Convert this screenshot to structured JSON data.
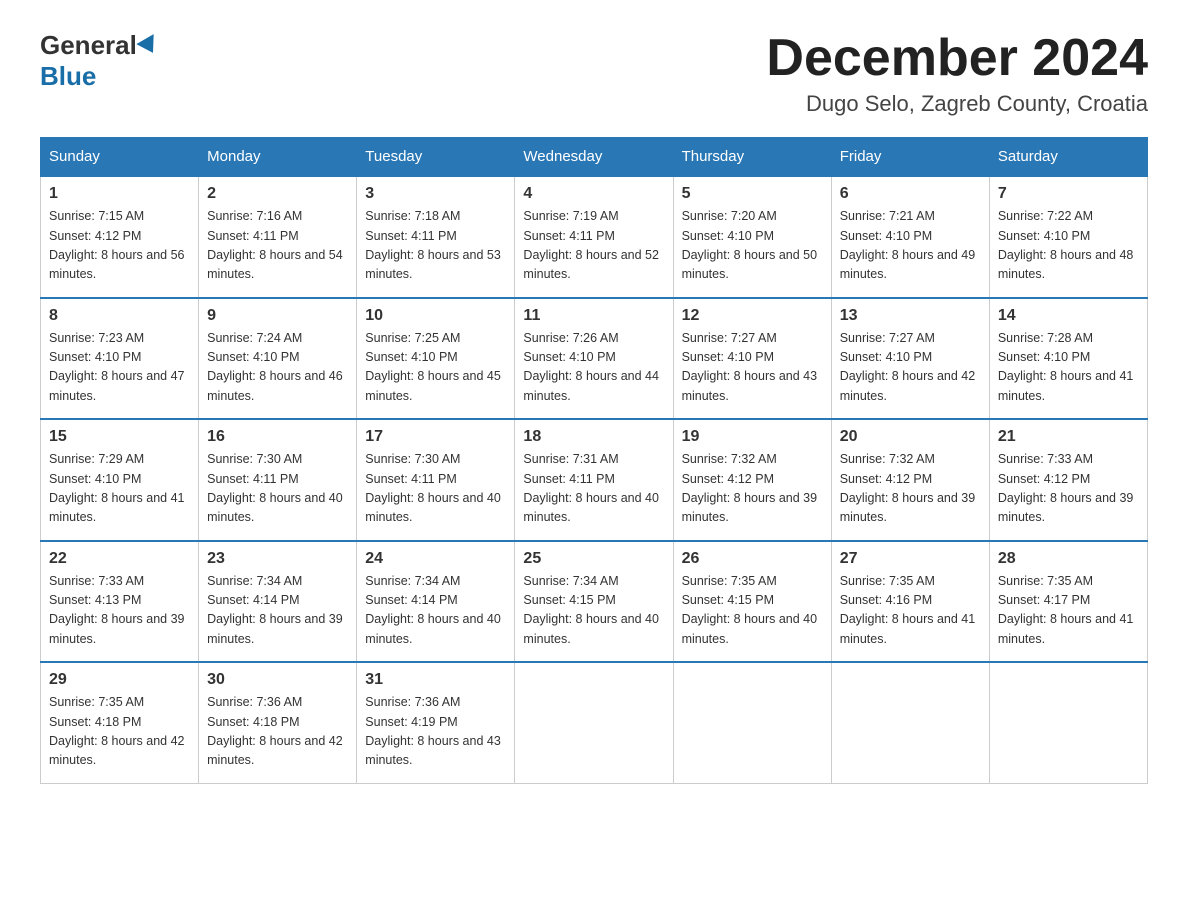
{
  "header": {
    "logo_general": "General",
    "logo_blue": "Blue",
    "month_year": "December 2024",
    "location": "Dugo Selo, Zagreb County, Croatia"
  },
  "days_of_week": [
    "Sunday",
    "Monday",
    "Tuesday",
    "Wednesday",
    "Thursday",
    "Friday",
    "Saturday"
  ],
  "weeks": [
    [
      {
        "day": "1",
        "sunrise": "7:15 AM",
        "sunset": "4:12 PM",
        "daylight": "8 hours and 56 minutes."
      },
      {
        "day": "2",
        "sunrise": "7:16 AM",
        "sunset": "4:11 PM",
        "daylight": "8 hours and 54 minutes."
      },
      {
        "day": "3",
        "sunrise": "7:18 AM",
        "sunset": "4:11 PM",
        "daylight": "8 hours and 53 minutes."
      },
      {
        "day": "4",
        "sunrise": "7:19 AM",
        "sunset": "4:11 PM",
        "daylight": "8 hours and 52 minutes."
      },
      {
        "day": "5",
        "sunrise": "7:20 AM",
        "sunset": "4:10 PM",
        "daylight": "8 hours and 50 minutes."
      },
      {
        "day": "6",
        "sunrise": "7:21 AM",
        "sunset": "4:10 PM",
        "daylight": "8 hours and 49 minutes."
      },
      {
        "day": "7",
        "sunrise": "7:22 AM",
        "sunset": "4:10 PM",
        "daylight": "8 hours and 48 minutes."
      }
    ],
    [
      {
        "day": "8",
        "sunrise": "7:23 AM",
        "sunset": "4:10 PM",
        "daylight": "8 hours and 47 minutes."
      },
      {
        "day": "9",
        "sunrise": "7:24 AM",
        "sunset": "4:10 PM",
        "daylight": "8 hours and 46 minutes."
      },
      {
        "day": "10",
        "sunrise": "7:25 AM",
        "sunset": "4:10 PM",
        "daylight": "8 hours and 45 minutes."
      },
      {
        "day": "11",
        "sunrise": "7:26 AM",
        "sunset": "4:10 PM",
        "daylight": "8 hours and 44 minutes."
      },
      {
        "day": "12",
        "sunrise": "7:27 AM",
        "sunset": "4:10 PM",
        "daylight": "8 hours and 43 minutes."
      },
      {
        "day": "13",
        "sunrise": "7:27 AM",
        "sunset": "4:10 PM",
        "daylight": "8 hours and 42 minutes."
      },
      {
        "day": "14",
        "sunrise": "7:28 AM",
        "sunset": "4:10 PM",
        "daylight": "8 hours and 41 minutes."
      }
    ],
    [
      {
        "day": "15",
        "sunrise": "7:29 AM",
        "sunset": "4:10 PM",
        "daylight": "8 hours and 41 minutes."
      },
      {
        "day": "16",
        "sunrise": "7:30 AM",
        "sunset": "4:11 PM",
        "daylight": "8 hours and 40 minutes."
      },
      {
        "day": "17",
        "sunrise": "7:30 AM",
        "sunset": "4:11 PM",
        "daylight": "8 hours and 40 minutes."
      },
      {
        "day": "18",
        "sunrise": "7:31 AM",
        "sunset": "4:11 PM",
        "daylight": "8 hours and 40 minutes."
      },
      {
        "day": "19",
        "sunrise": "7:32 AM",
        "sunset": "4:12 PM",
        "daylight": "8 hours and 39 minutes."
      },
      {
        "day": "20",
        "sunrise": "7:32 AM",
        "sunset": "4:12 PM",
        "daylight": "8 hours and 39 minutes."
      },
      {
        "day": "21",
        "sunrise": "7:33 AM",
        "sunset": "4:12 PM",
        "daylight": "8 hours and 39 minutes."
      }
    ],
    [
      {
        "day": "22",
        "sunrise": "7:33 AM",
        "sunset": "4:13 PM",
        "daylight": "8 hours and 39 minutes."
      },
      {
        "day": "23",
        "sunrise": "7:34 AM",
        "sunset": "4:14 PM",
        "daylight": "8 hours and 39 minutes."
      },
      {
        "day": "24",
        "sunrise": "7:34 AM",
        "sunset": "4:14 PM",
        "daylight": "8 hours and 40 minutes."
      },
      {
        "day": "25",
        "sunrise": "7:34 AM",
        "sunset": "4:15 PM",
        "daylight": "8 hours and 40 minutes."
      },
      {
        "day": "26",
        "sunrise": "7:35 AM",
        "sunset": "4:15 PM",
        "daylight": "8 hours and 40 minutes."
      },
      {
        "day": "27",
        "sunrise": "7:35 AM",
        "sunset": "4:16 PM",
        "daylight": "8 hours and 41 minutes."
      },
      {
        "day": "28",
        "sunrise": "7:35 AM",
        "sunset": "4:17 PM",
        "daylight": "8 hours and 41 minutes."
      }
    ],
    [
      {
        "day": "29",
        "sunrise": "7:35 AM",
        "sunset": "4:18 PM",
        "daylight": "8 hours and 42 minutes."
      },
      {
        "day": "30",
        "sunrise": "7:36 AM",
        "sunset": "4:18 PM",
        "daylight": "8 hours and 42 minutes."
      },
      {
        "day": "31",
        "sunrise": "7:36 AM",
        "sunset": "4:19 PM",
        "daylight": "8 hours and 43 minutes."
      },
      null,
      null,
      null,
      null
    ]
  ],
  "labels": {
    "sunrise": "Sunrise:",
    "sunset": "Sunset:",
    "daylight": "Daylight:"
  }
}
